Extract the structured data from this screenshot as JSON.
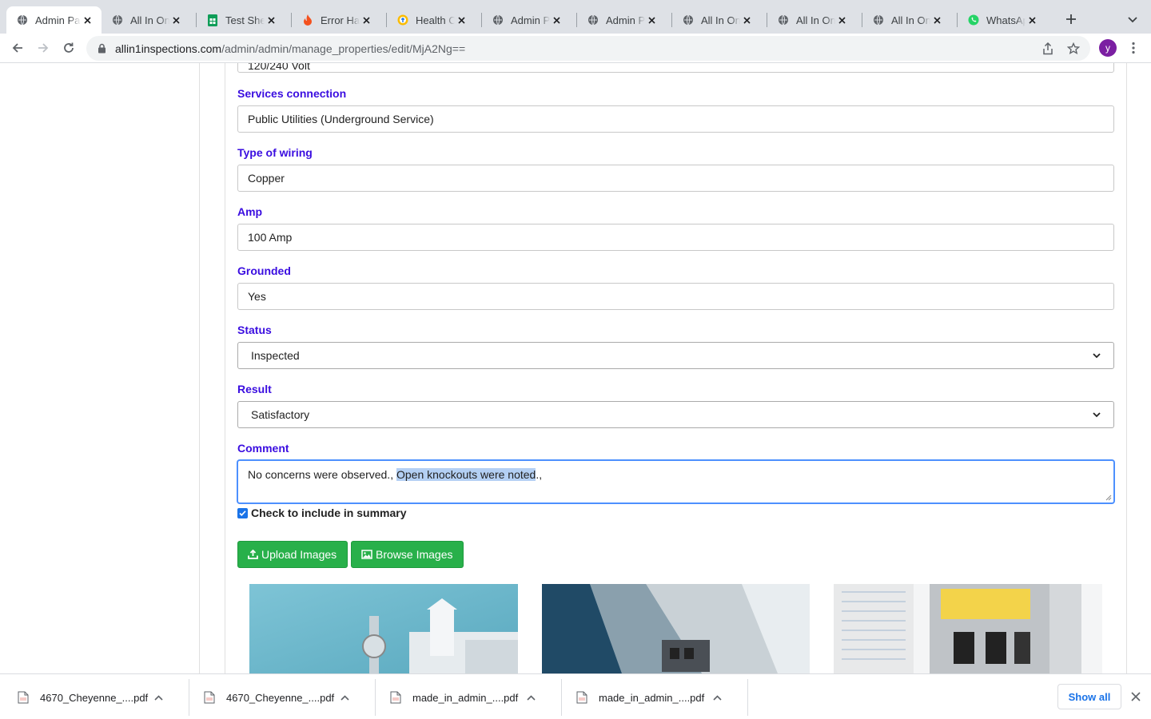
{
  "browser": {
    "tabs": [
      {
        "title": "Admin Pa",
        "icon": "globe-icon",
        "active": true
      },
      {
        "title": "All In One",
        "icon": "globe-icon"
      },
      {
        "title": "Test Shee",
        "icon": "sheets-icon"
      },
      {
        "title": "Error Han",
        "icon": "fire-icon"
      },
      {
        "title": "Health Ca",
        "icon": "health-icon"
      },
      {
        "title": "Admin Pa",
        "icon": "globe-icon"
      },
      {
        "title": "Admin Pa",
        "icon": "globe-icon"
      },
      {
        "title": "All In One",
        "icon": "globe-icon"
      },
      {
        "title": "All In One",
        "icon": "globe-icon"
      },
      {
        "title": "All In One",
        "icon": "globe-icon"
      },
      {
        "title": "WhatsAp",
        "icon": "whatsapp-icon"
      }
    ],
    "url_host": "allin1inspections.com",
    "url_path": "/admin/admin/manage_properties/edit/MjA2Ng==",
    "profile_initial": "y"
  },
  "form": {
    "prev_value_partial": "120/240 Volt",
    "services_connection": {
      "label": "Services connection",
      "value": "Public Utilities (Underground Service)"
    },
    "type_of_wiring": {
      "label": "Type of wiring",
      "value": "Copper"
    },
    "amp": {
      "label": "Amp",
      "value": "100 Amp"
    },
    "grounded": {
      "label": "Grounded",
      "value": "Yes"
    },
    "status": {
      "label": "Status",
      "value": "Inspected"
    },
    "result": {
      "label": "Result",
      "value": "Satisfactory"
    },
    "comment": {
      "label": "Comment",
      "text_before": "No concerns were observed., ",
      "text_selected": "Open knockouts were noted",
      "text_after": ".,"
    },
    "include_summary": {
      "label": "Check to include in summary",
      "checked": true
    },
    "upload_label": "Upload Images",
    "browse_label": "Browse Images"
  },
  "downloads": {
    "items": [
      "4670_Cheyenne_....pdf",
      "4670_Cheyenne_....pdf",
      "made_in_admin_....pdf",
      "made_in_admin_....pdf"
    ],
    "show_all": "Show all"
  },
  "colors": {
    "label": "#3a0de0",
    "button": "#28b04a",
    "accent": "#1a73e8"
  }
}
